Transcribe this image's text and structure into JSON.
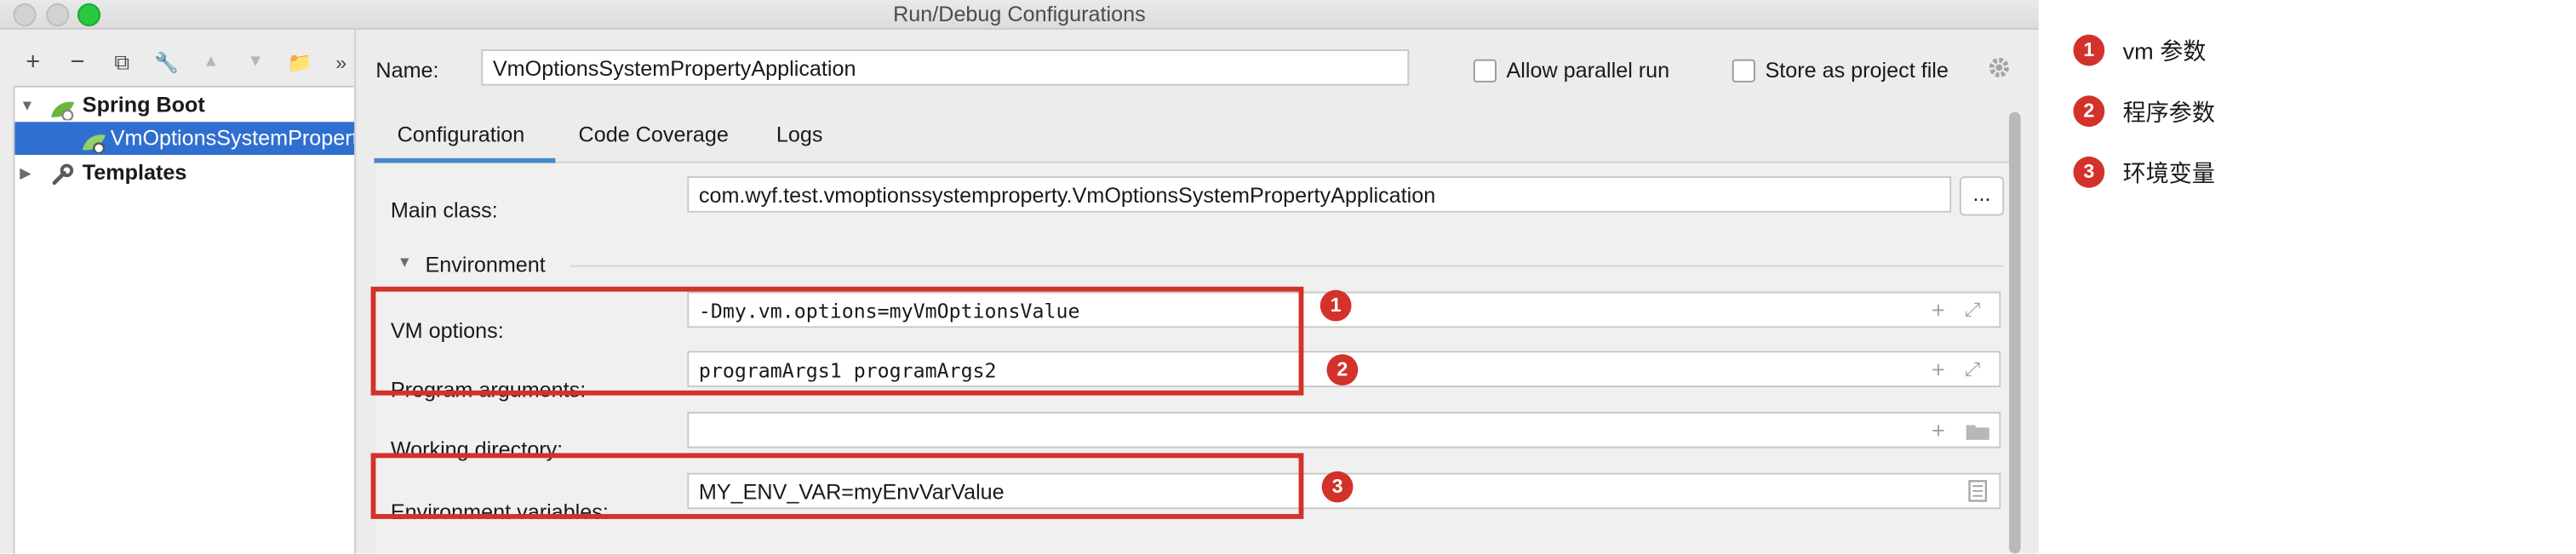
{
  "window": {
    "title": "Run/Debug Configurations"
  },
  "toolbar": {
    "add": "+",
    "remove": "−",
    "copy": "⧉",
    "edit": "🔧",
    "move_up": "▲",
    "move_down": "▼",
    "new_folder": "📁",
    "more": "»"
  },
  "tree": {
    "items": [
      {
        "label": "Spring Boot",
        "expander": "▼"
      },
      {
        "label": "VmOptionsSystemPropertyApplication"
      },
      {
        "label": "Templates",
        "expander": "▶"
      }
    ]
  },
  "header": {
    "name_label": "Name:",
    "name_value": "VmOptionsSystemPropertyApplication",
    "allow_parallel_label": "Allow parallel run",
    "store_project_label": "Store as project file"
  },
  "tabs": [
    {
      "label": "Configuration",
      "active": true
    },
    {
      "label": "Code Coverage"
    },
    {
      "label": "Logs"
    }
  ],
  "form": {
    "main_class_label": "Main class:",
    "main_class_value": "com.wyf.test.vmoptionssystemproperty.VmOptionsSystemPropertyApplication",
    "browse_label": "...",
    "environment_label": "Environment",
    "vm_options_label": "VM options:",
    "vm_options_value": "-Dmy.vm.options=myVmOptionsValue",
    "program_args_label": "Program arguments:",
    "program_args_value": "programArgs1 programArgs2",
    "working_dir_label": "Working directory:",
    "working_dir_value": "",
    "env_vars_label": "Environment variables:",
    "env_vars_value": "MY_ENV_VAR=myEnvVarValue"
  },
  "annotations": {
    "badges": [
      "1",
      "2",
      "3"
    ],
    "legend": [
      {
        "num": "1",
        "text": "vm 参数"
      },
      {
        "num": "2",
        "text": "程序参数"
      },
      {
        "num": "3",
        "text": "环境变量"
      }
    ]
  },
  "colors": {
    "accent": "#4a87c9",
    "annotation_red": "#d3322a",
    "selection": "#2f6fd0"
  }
}
